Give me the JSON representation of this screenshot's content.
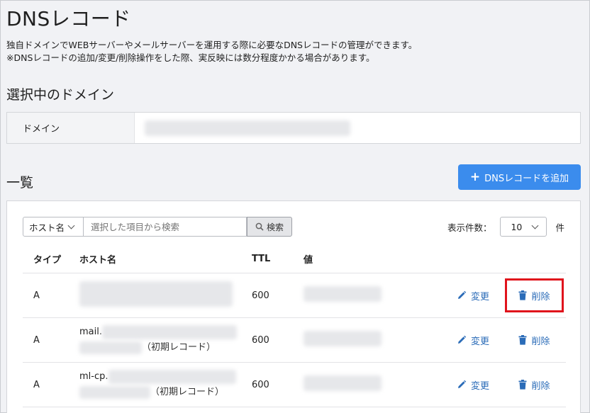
{
  "page": {
    "title": "DNSレコード",
    "desc1": "独自ドメインでWEBサーバーやメールサーバーを運用する際に必要なDNSレコードの管理ができます。",
    "desc2": "※DNSレコードの追加/変更/削除操作をした際、実反映には数分程度かかる場合があります。"
  },
  "domain_section": {
    "title": "選択中のドメイン",
    "label": "ドメイン"
  },
  "list_section": {
    "title": "一覧",
    "add_button": "DNSレコードを追加"
  },
  "search": {
    "field_select": "ホスト名",
    "placeholder": "選択した項目から検索",
    "button": "検索"
  },
  "per_page": {
    "label": "表示件数：",
    "value": "10",
    "unit": "件"
  },
  "table": {
    "headers": {
      "type": "タイプ",
      "host": "ホスト名",
      "ttl": "TTL",
      "value": "値"
    },
    "rows": [
      {
        "type": "A",
        "host_prefix": "",
        "note": "",
        "ttl": "600"
      },
      {
        "type": "A",
        "host_prefix": "mail.",
        "note": "（初期レコード）",
        "ttl": "600"
      },
      {
        "type": "A",
        "host_prefix": "ml-cp.",
        "note": "（初期レコード）",
        "ttl": "600"
      }
    ],
    "edit_label": "変更",
    "delete_label": "削除"
  },
  "colors": {
    "accent": "#3b8ced",
    "link": "#2b6cb8",
    "highlight": "#e0131c"
  }
}
